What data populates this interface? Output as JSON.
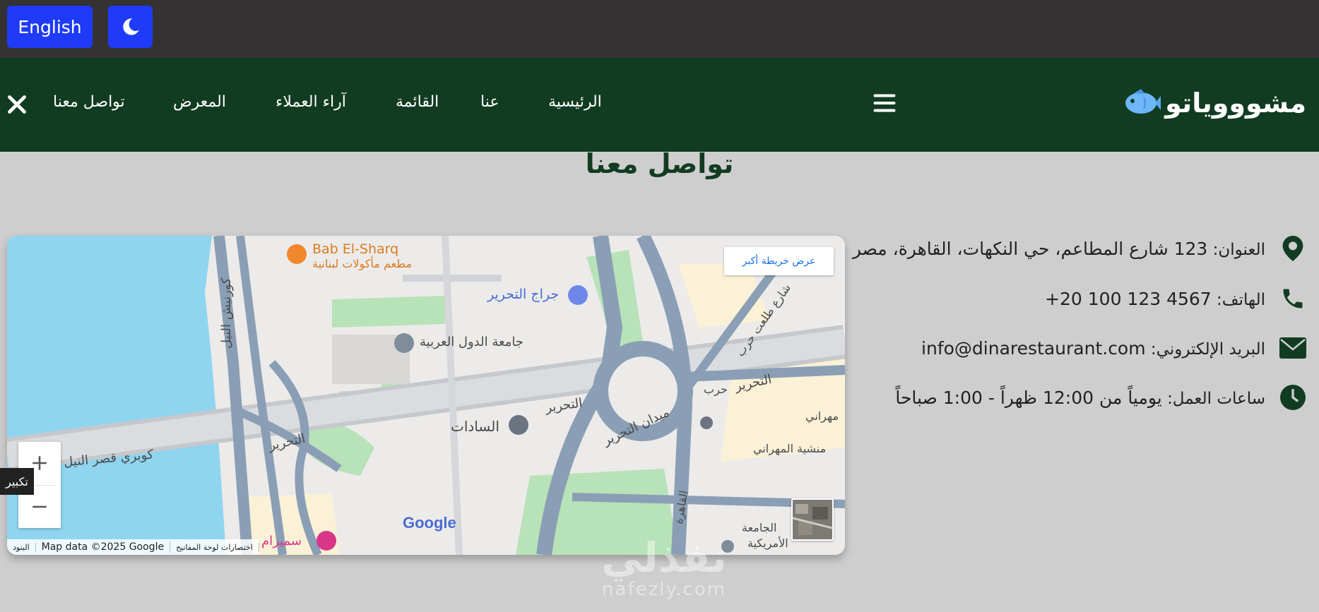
{
  "topbar": {
    "language_button": "English",
    "theme_icon": "moon-icon"
  },
  "nav": {
    "brand": "مشوووياتو",
    "brand_icon": "fish-icon",
    "items": [
      "الرئيسية",
      "عنا",
      "القائمة",
      "آراء العملاء",
      "المعرض",
      "تواصل معنا"
    ],
    "close_icon": "close-icon",
    "menu_icon": "hamburger-icon"
  },
  "page": {
    "title": "تواصل معنا"
  },
  "contact": {
    "address_label": "العنوان:",
    "address_value": "123 شارع المطاعم، حي النكهات، القاهرة، مصر",
    "phone_label": "الهاتف:",
    "phone_value": "+20 100 123 4567",
    "email_label": "البريد الإلكتروني:",
    "email_value": "info@dinarestaurant.com",
    "hours_label": "ساعات العمل:",
    "hours_value": "يومياً من 12:00 ظهراً - 1:00 صباحاً"
  },
  "map": {
    "view_larger": "عرض خريطة أكبر",
    "zoom_in": "+",
    "zoom_out": "−",
    "tooltip": "تكبير",
    "attribution_map_data": "Map data ©2025 Google",
    "attribution_shortcuts": "اختصارات لوحة المفاتيح",
    "attribution_terms": "البنود",
    "google": "Google",
    "labels": {
      "bab_elsharq": "Bab El-Sharq",
      "bab_elsharq_sub": "مطعم مأكولات لبنانية",
      "garage": "جراج التحرير",
      "arab_league": "جامعة الدول العربية",
      "corniche": "كورنيش النيل",
      "tahrir1": "التحرير",
      "tahrir2": "التحرير",
      "tahrir3": "التحرير",
      "sadat": "السادات",
      "tahrir_square": "ميدان التحرير",
      "bridge": "كوبري قصر النيل",
      "talaat_harb": "شارع طلعت حرب",
      "harb": "حرب",
      "mahrani": "مهراني",
      "manshiet": "منشية المهراني",
      "cairo": "القاهرة",
      "univ1": "الجامعة",
      "univ2": "الأمريكية",
      "semiramis": "سميرام"
    }
  },
  "watermark": {
    "line1": "نفذلي",
    "line2": "nafezly.com"
  },
  "colors": {
    "topbar": "#343233",
    "nav": "#123c22",
    "accent_blue": "#1f3bf7",
    "background": "#cfcecf"
  }
}
